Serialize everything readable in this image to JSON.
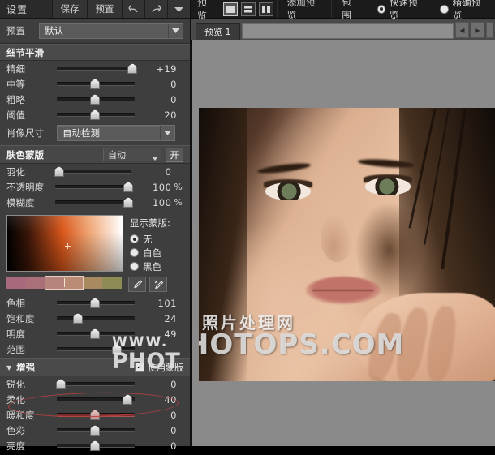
{
  "left_panel": {
    "title": "设置",
    "buttons": {
      "save": "保存",
      "preset": "预置",
      "undo": "undo-icon",
      "redo": "redo-icon",
      "menu": "chevron-down-icon"
    },
    "preset_row": {
      "label": "预置",
      "value": "默认"
    },
    "section_detail": {
      "title": "细节平滑",
      "sliders": [
        {
          "name": "精细",
          "value": "+19",
          "pct": 96,
          "unit": ""
        },
        {
          "name": "中等",
          "value": "0",
          "pct": 48,
          "unit": ""
        },
        {
          "name": "粗略",
          "value": "0",
          "pct": 48,
          "unit": ""
        },
        {
          "name": "阈值",
          "value": "20",
          "pct": 48,
          "unit": ""
        }
      ],
      "portrait_size": {
        "label": "肖像尺寸",
        "value": "自动检测"
      }
    },
    "section_skinmask": {
      "title": "肤色蒙版",
      "mode": "自动",
      "toggle": "开",
      "sliders": [
        {
          "name": "羽化",
          "value": "0",
          "pct": 4,
          "unit": ""
        },
        {
          "name": "不透明度",
          "value": "100",
          "pct": 96,
          "unit": "%"
        },
        {
          "name": "模糊度",
          "value": "100",
          "pct": 96,
          "unit": "%"
        }
      ],
      "show_mask": {
        "label": "显示蒙版:",
        "options": [
          {
            "label": "无",
            "selected": true
          },
          {
            "label": "白色",
            "selected": false
          },
          {
            "label": "黑色",
            "selected": false
          }
        ]
      },
      "tools": [
        "eyedropper-icon",
        "eyedropper-plus-icon"
      ],
      "color_sliders": [
        {
          "name": "色相",
          "value": "101",
          "pct": 48,
          "unit": ""
        },
        {
          "name": "饱和度",
          "value": "24",
          "pct": 26,
          "unit": ""
        },
        {
          "name": "明度",
          "value": "49",
          "pct": 48,
          "unit": ""
        },
        {
          "name": "范围",
          "value": "",
          "pct": 76,
          "unit": ""
        }
      ]
    },
    "section_enhance": {
      "title": "增强",
      "use_mask_label": "使用蒙版",
      "use_mask_checked": true,
      "sliders": [
        {
          "name": "锐化",
          "value": "0",
          "pct": 4,
          "unit": ""
        },
        {
          "name": "柔化",
          "value": "40",
          "pct": 90,
          "unit": ""
        },
        {
          "name": "暖和度",
          "value": "0",
          "pct": 48,
          "unit": "",
          "warm": true
        },
        {
          "name": "色彩",
          "value": "0",
          "pct": 48,
          "unit": ""
        },
        {
          "name": "亮度",
          "value": "0",
          "pct": 48,
          "unit": ""
        }
      ]
    }
  },
  "right_panel": {
    "title": "预览",
    "view_modes": [
      {
        "icon": "single-view-icon",
        "selected": true
      },
      {
        "icon": "split-horizontal-icon",
        "selected": false
      },
      {
        "icon": "split-vertical-icon",
        "selected": false
      }
    ],
    "buttons": {
      "add_preview": "添加预览",
      "bracket": "包围"
    },
    "quality": [
      {
        "label": "快速预览",
        "selected": true
      },
      {
        "label": "精确预览",
        "selected": false
      }
    ],
    "tab": "预览 1",
    "nav": {
      "prev": "left-arrow-icon",
      "next": "right-arrow-icon"
    },
    "watermark": {
      "line1": "照片处理网",
      "line2": "PHOTOPS.COM",
      "line3": "WWW.",
      "line4": "PHOT"
    }
  },
  "colors": {
    "panel_bg": "#3e3e3e",
    "header_bg": "#2a2a2a",
    "canvas_bg": "#8a8a8a",
    "annotation_red": "#b5403f",
    "warm_track": "#7e2b2b"
  }
}
